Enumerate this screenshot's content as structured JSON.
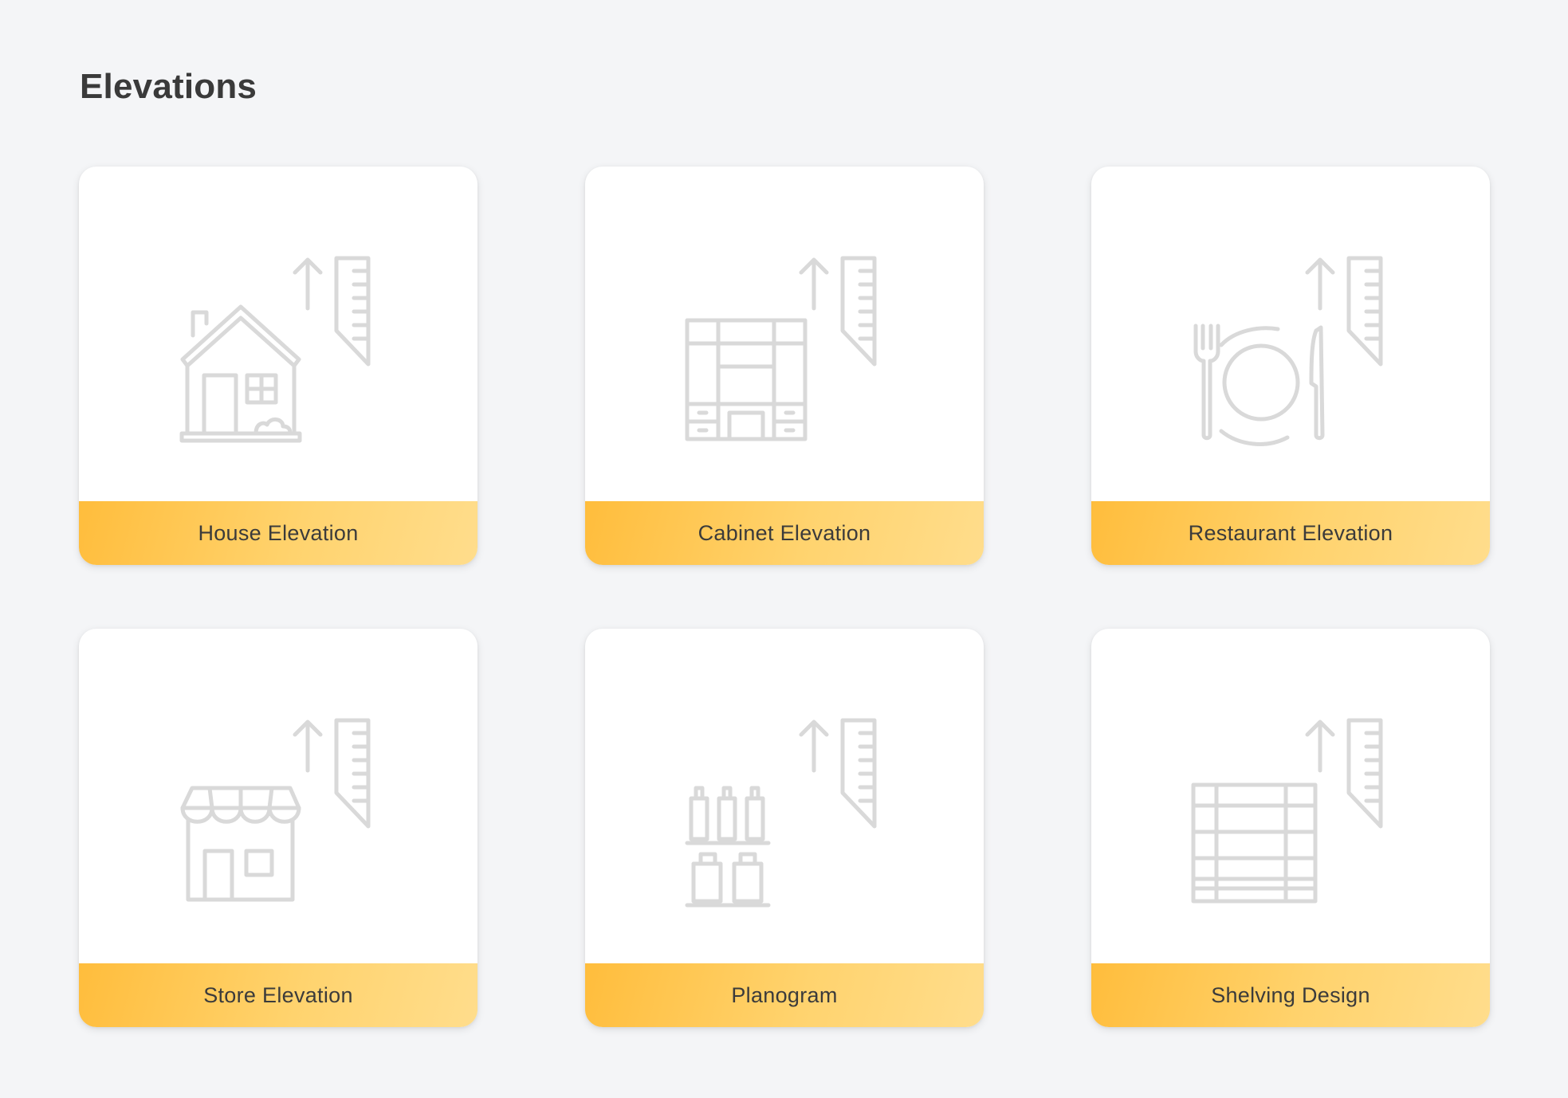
{
  "page": {
    "title": "Elevations"
  },
  "cards": [
    {
      "label": "House Elevation",
      "icon": "house-elevation-icon"
    },
    {
      "label": "Cabinet Elevation",
      "icon": "cabinet-elevation-icon"
    },
    {
      "label": "Restaurant Elevation",
      "icon": "restaurant-elevation-icon"
    },
    {
      "label": "Store Elevation",
      "icon": "store-elevation-icon"
    },
    {
      "label": "Planogram",
      "icon": "planogram-icon"
    },
    {
      "label": "Shelving Design",
      "icon": "shelving-design-icon"
    }
  ],
  "colors": {
    "background": "#f4f5f7",
    "card": "#ffffff",
    "footer_gradient_start": "#ffbd3c",
    "footer_gradient_end": "#ffdd8c",
    "icon_stroke": "#d9d9d9",
    "title_text": "#3a3a3a"
  }
}
